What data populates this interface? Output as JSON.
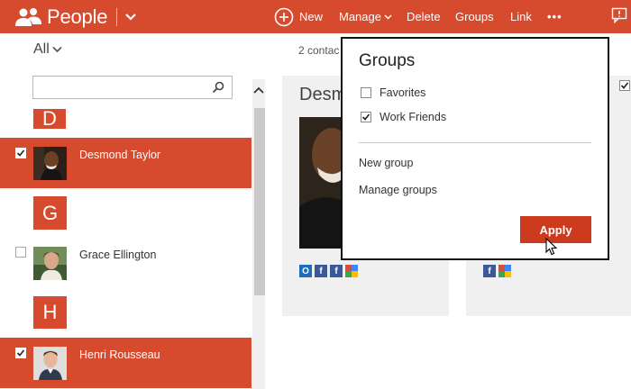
{
  "app": {
    "title": "People"
  },
  "toolbar": {
    "new_label": "New",
    "manage_label": "Manage",
    "delete_label": "Delete",
    "groups_label": "Groups",
    "link_label": "Link",
    "more_label": "•••"
  },
  "filter": {
    "label": "All"
  },
  "search": {
    "value": "",
    "placeholder": ""
  },
  "contacts": {
    "letters": [
      "D",
      "G",
      "H"
    ],
    "items": [
      {
        "name": "Desmond Taylor",
        "selected": true
      },
      {
        "name": "Grace Ellington",
        "selected": false
      },
      {
        "name": "Henri Rousseau",
        "selected": true
      }
    ]
  },
  "main": {
    "count_text": "2 contac",
    "card_name": "Desm"
  },
  "popup": {
    "title": "Groups",
    "options": [
      {
        "label": "Favorites",
        "checked": false
      },
      {
        "label": "Work Friends",
        "checked": true
      }
    ],
    "new_group": "New group",
    "manage_groups": "Manage groups",
    "apply_label": "Apply"
  },
  "icons": {
    "brand": "people-icon",
    "notifications": "notification-icon",
    "search": "search-icon",
    "services": [
      "outlook-icon",
      "facebook-icon",
      "google-icon"
    ]
  },
  "colors": {
    "accent": "#d64a2e",
    "apply": "#cc3a1d",
    "card_bg": "#f0f0f0"
  }
}
